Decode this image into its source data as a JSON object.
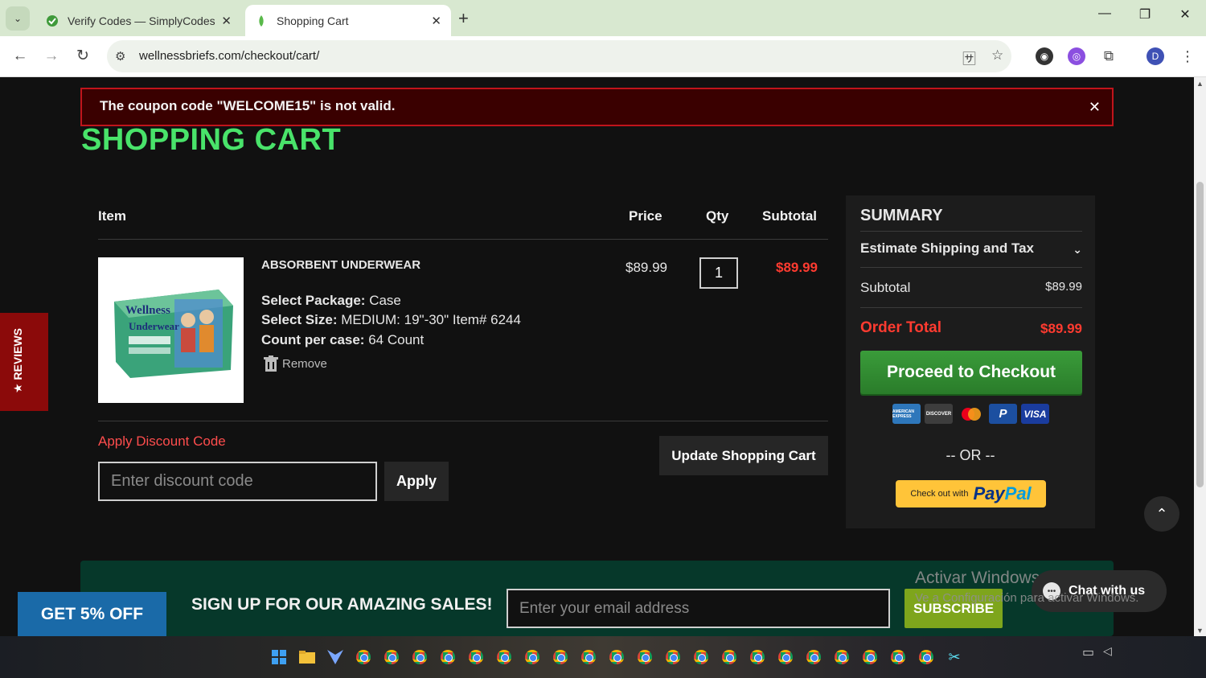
{
  "browser": {
    "tabs": [
      {
        "title": "Verify Codes — SimplyCodes",
        "active": false
      },
      {
        "title": "Shopping Cart",
        "active": true
      }
    ],
    "new_tab": "+",
    "url": "wellnessbriefs.com/checkout/cart/",
    "profile_initial": "D"
  },
  "alert": {
    "message": "The coupon code \"WELCOME15\" is not valid.",
    "close": "✕"
  },
  "page": {
    "title": "SHOPPING CART"
  },
  "cart": {
    "headers": {
      "item": "Item",
      "price": "Price",
      "qty": "Qty",
      "subtotal": "Subtotal"
    },
    "items": [
      {
        "name": "ABSORBENT UNDERWEAR",
        "options": [
          {
            "label": "Select Package:",
            "value": "Case"
          },
          {
            "label": "Select Size:",
            "value": "MEDIUM: 19\"-30\" Item# 6244"
          },
          {
            "label": "Count per case:",
            "value": "64 Count"
          }
        ],
        "remove": "Remove",
        "price": "$89.99",
        "qty": "1",
        "subtotal": "$89.99",
        "image_text": "Wellness Absorbent Underwear"
      }
    ],
    "discount": {
      "label": "Apply Discount Code",
      "placeholder": "Enter discount code",
      "apply": "Apply"
    },
    "update": "Update Shopping Cart"
  },
  "summary": {
    "title": "SUMMARY",
    "shipping": "Estimate Shipping and Tax",
    "subtotal_label": "Subtotal",
    "subtotal_value": "$89.99",
    "total_label": "Order Total",
    "total_value": "$89.99",
    "checkout": "Proceed to Checkout",
    "cards": [
      {
        "name": "AMERICAN EXPRESS",
        "color": "#2e77bb"
      },
      {
        "name": "DISCOVER",
        "color": "#3d3d3d"
      },
      {
        "name": "",
        "color": "#1c1c1c"
      },
      {
        "name": "P",
        "color": "#1c4fa0"
      },
      {
        "name": "VISA",
        "color": "#1a3c9e"
      }
    ],
    "or": "-- OR --",
    "paypal_small": "Check out with",
    "paypal_a": "Pay",
    "paypal_b": "Pal"
  },
  "reviews_tab": "★ REVIEWS",
  "newsletter": {
    "title": "SIGN UP FOR OUR AMAZING SALES!",
    "placeholder": "Enter your email address",
    "subscribe": "SUBSCRIBE"
  },
  "promo": "GET 5% OFF",
  "chat": "Chat with us",
  "windows_watermark": {
    "line1": "Activar Windows",
    "line2": "Ve a Configuración para activar Windows."
  },
  "colors": {
    "title_green": "#49e36a",
    "error_red": "#ff3b30",
    "checkout_green": "#3a9c3a",
    "subscribe_green": "#7ea51c",
    "promo_blue": "#1a6aa8"
  }
}
